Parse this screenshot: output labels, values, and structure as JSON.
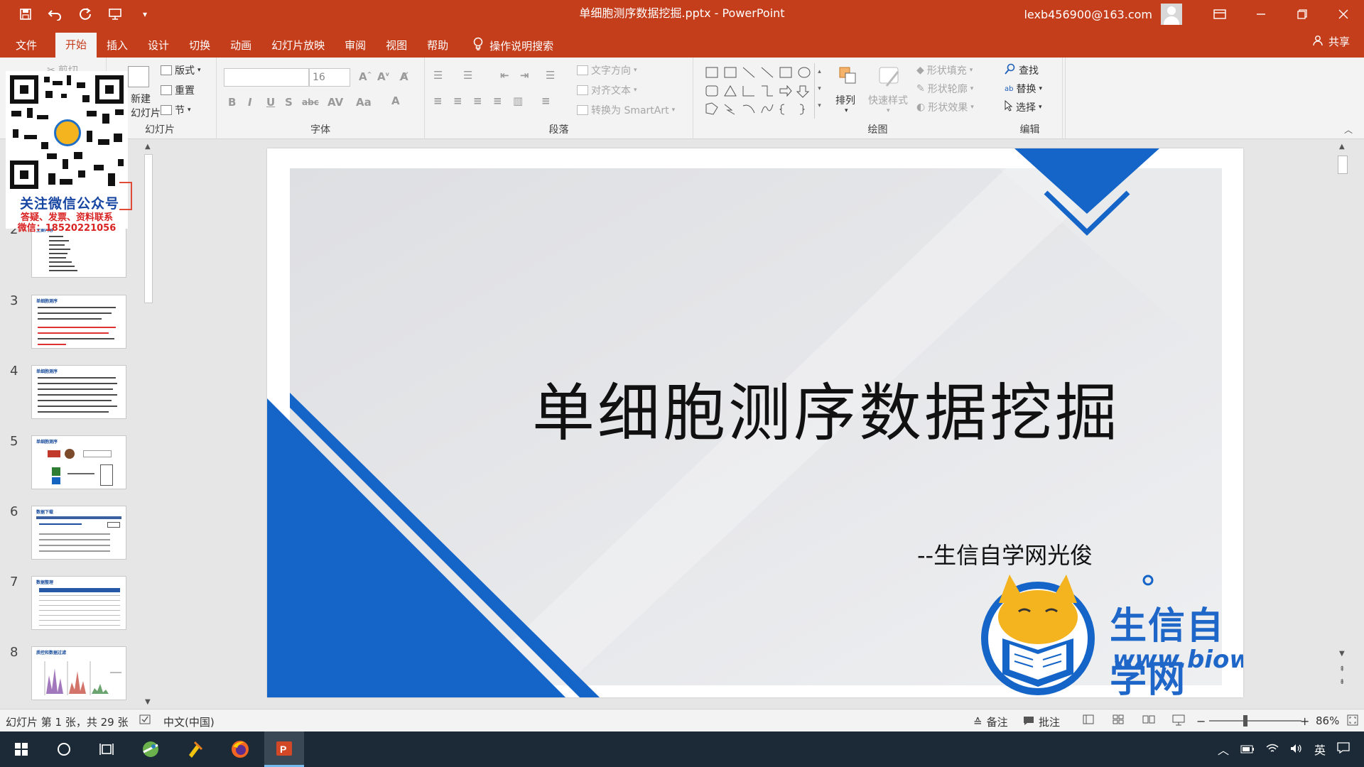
{
  "window": {
    "title": "单细胞测序数据挖掘.pptx  -  PowerPoint",
    "user_email": "lexb456900@163.com"
  },
  "qat": {
    "icons": [
      "save-icon",
      "undo-icon",
      "redo-icon",
      "present-icon",
      "customize-icon"
    ]
  },
  "tabs": [
    {
      "label": "文件"
    },
    {
      "label": "开始"
    },
    {
      "label": "插入"
    },
    {
      "label": "设计"
    },
    {
      "label": "切换"
    },
    {
      "label": "动画"
    },
    {
      "label": "幻灯片放映"
    },
    {
      "label": "审阅"
    },
    {
      "label": "视图"
    },
    {
      "label": "帮助"
    }
  ],
  "tell_me": "操作说明搜索",
  "share": "共享",
  "ribbon": {
    "clipboard": {
      "cut": "剪切"
    },
    "slides": {
      "label": "幻灯片",
      "new_slide": "新建",
      "new_slide2": "幻灯片",
      "layout": "版式",
      "reset": "重置",
      "section": "节"
    },
    "font": {
      "label": "字体",
      "font_name": "",
      "font_size": "16"
    },
    "paragraph": {
      "label": "段落",
      "text_direction": "文字方向",
      "align_text": "对齐文本",
      "smartart": "转换为 SmartArt"
    },
    "drawing": {
      "label": "绘图",
      "arrange": "排列",
      "quick_styles": "快速样式",
      "shape_fill": "形状填充",
      "shape_outline": "形状轮廓",
      "shape_effects": "形状效果"
    },
    "editing": {
      "label": "编辑",
      "find": "查找",
      "replace": "替换",
      "select": "选择"
    }
  },
  "overlay": {
    "qr_title": "关注微信公众号",
    "qr_line1": "答疑、发票、资料联系",
    "qr_line2": "微信：18520221056"
  },
  "thumbnails": [
    {
      "num": "2",
      "title": "主要内容"
    },
    {
      "num": "3",
      "title": "单细胞测序"
    },
    {
      "num": "4",
      "title": "单细胞测序"
    },
    {
      "num": "5",
      "title": "单细胞测序"
    },
    {
      "num": "6",
      "title": "数据下载"
    },
    {
      "num": "7",
      "title": "数据整理"
    },
    {
      "num": "8",
      "title": "质控和数据过滤"
    }
  ],
  "slide": {
    "title": "单细胞测序数据挖掘",
    "subtitle": "--生信自学网光俊",
    "logo_cn": "生信自学网",
    "logo_url": "www.biowolf.cn",
    "accent": "#1565c8"
  },
  "status": {
    "slide_info": "幻灯片 第 1 张，共 29 张",
    "language": "中文(中国)",
    "notes": "备注",
    "comments": "批注",
    "zoom": "86%"
  },
  "taskbar": {
    "ime": "英"
  }
}
